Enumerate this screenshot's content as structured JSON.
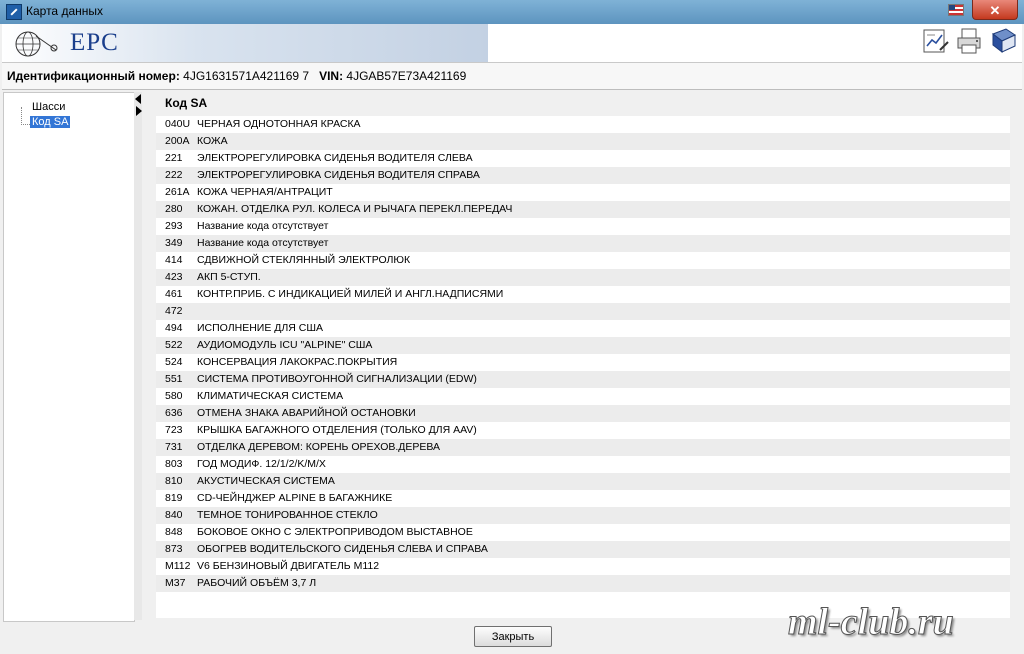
{
  "window": {
    "title": "Карта данных",
    "close_glyph": "✕"
  },
  "header": {
    "brand": "EPC"
  },
  "info": {
    "id_label": "Идентификационный номер:",
    "id_value": "4JG1631571A421169 7",
    "vin_label": "VIN:",
    "vin_value": "4JGAB57E73A421169"
  },
  "tree": {
    "items": [
      {
        "label": "Шасси"
      },
      {
        "label": "Код SA"
      }
    ]
  },
  "table": {
    "header": "Код SA",
    "rows": [
      {
        "code": "040U",
        "desc": "ЧЕРНАЯ ОДНОТОННАЯ КРАСКА"
      },
      {
        "code": "200A",
        "desc": "КОЖА"
      },
      {
        "code": "221",
        "desc": "ЭЛЕКТРОРЕГУЛИРОВКА СИДЕНЬЯ ВОДИТЕЛЯ СЛЕВА"
      },
      {
        "code": "222",
        "desc": "ЭЛЕКТРОРЕГУЛИРОВКА СИДЕНЬЯ ВОДИТЕЛЯ СПРАВА"
      },
      {
        "code": "261A",
        "desc": "КОЖА ЧЕРНАЯ/АНТРАЦИТ"
      },
      {
        "code": "280",
        "desc": "КОЖАН. ОТДЕЛКА РУЛ. КОЛЕСА И РЫЧАГА ПЕРЕКЛ.ПЕРЕДАЧ"
      },
      {
        "code": "293",
        "desc": "Название кода отсутствует"
      },
      {
        "code": "349",
        "desc": "Название кода отсутствует"
      },
      {
        "code": "414",
        "desc": "СДВИЖНОЙ СТЕКЛЯННЫЙ ЭЛЕКТРОЛЮК"
      },
      {
        "code": "423",
        "desc": "АКП 5-СТУП."
      },
      {
        "code": "461",
        "desc": "КОНТР.ПРИБ. С ИНДИКАЦИЕЙ МИЛЕЙ И АНГЛ.НАДПИСЯМИ"
      },
      {
        "code": "472",
        "desc": ""
      },
      {
        "code": "494",
        "desc": "ИСПОЛНЕНИЕ ДЛЯ США"
      },
      {
        "code": "522",
        "desc": "АУДИОМОДУЛЬ ICU \"ALPINE\" США"
      },
      {
        "code": "524",
        "desc": "КОНСЕРВАЦИЯ ЛАКОКРАС.ПОКРЫТИЯ"
      },
      {
        "code": "551",
        "desc": "СИСТЕМА ПРОТИВОУГОННОЙ СИГНАЛИЗАЦИИ (EDW)"
      },
      {
        "code": "580",
        "desc": "КЛИМАТИЧЕСКАЯ СИСТЕМА"
      },
      {
        "code": "636",
        "desc": "ОТМЕНА ЗНАКА АВАРИЙНОЙ ОСТАНОВКИ"
      },
      {
        "code": "723",
        "desc": "КРЫШКА БАГАЖНОГО ОТДЕЛЕНИЯ (ТОЛЬКО ДЛЯ AAV)"
      },
      {
        "code": "731",
        "desc": "ОТДЕЛКА ДЕРЕВОМ: КОРЕНЬ ОРЕХОВ.ДЕРЕВА"
      },
      {
        "code": "803",
        "desc": "ГОД МОДИФ. 12/1/2/K/M/X"
      },
      {
        "code": "810",
        "desc": "АКУСТИЧЕСКАЯ СИСТЕМА"
      },
      {
        "code": "819",
        "desc": "CD-ЧЕЙНДЖЕР ALPINE В БАГАЖНИКЕ"
      },
      {
        "code": "840",
        "desc": "ТЕМНОЕ ТОНИРОВАННОЕ СТЕКЛО"
      },
      {
        "code": "848",
        "desc": "БОКОВОЕ ОКНО С ЭЛЕКТРОПРИВОДОМ ВЫСТАВНОЕ"
      },
      {
        "code": "873",
        "desc": "ОБОГРЕВ ВОДИТЕЛЬСКОГО СИДЕНЬЯ СЛЕВА И СПРАВА"
      },
      {
        "code": "M112",
        "desc": "V6 БЕНЗИНОВЫЙ ДВИГАТЕЛЬ M112"
      },
      {
        "code": "M37",
        "desc": "РАБОЧИЙ ОБЪЁМ 3,7 Л"
      }
    ]
  },
  "footer": {
    "close_label": "Закрыть"
  },
  "watermark": "ml-club.ru"
}
